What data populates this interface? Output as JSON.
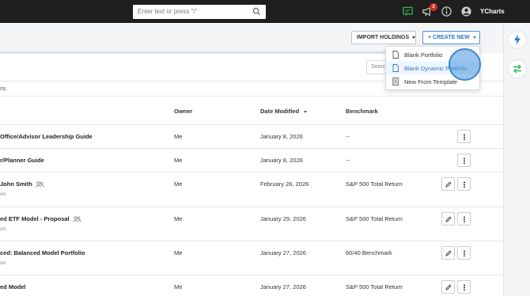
{
  "topbar": {
    "search_placeholder": "Enter text or press \"/\"",
    "notification_count": "2",
    "brand": "YCharts"
  },
  "toolbar": {
    "import_label": "IMPORT HOLDINGS",
    "create_label": "+ CREATE NEW",
    "search_placeholder": "Search"
  },
  "columns_fragment": "ns",
  "table": {
    "headers": {
      "owner": "Owner",
      "date_modified": "Date Modified",
      "benchmark": "Benchmark"
    },
    "rows": [
      {
        "name": "Office/Advisor Leadership Guide",
        "sub": "",
        "owner": "Me",
        "date": "January 8, 2026",
        "benchmark": "--",
        "shared": false,
        "editable": false
      },
      {
        "name": "r/Planner Guide",
        "sub": "",
        "owner": "Me",
        "date": "January 8, 2026",
        "benchmark": "--",
        "shared": false,
        "editable": false
      },
      {
        "name": "John Smith",
        "sub": "on",
        "owner": "Me",
        "date": "February 26, 2026",
        "benchmark": "S&P 500 Total Return",
        "shared": true,
        "editable": true
      },
      {
        "name": "ed ETF Model - Proposal",
        "sub": "on",
        "owner": "Me",
        "date": "January 29, 2026",
        "benchmark": "S&P 500 Total Return",
        "shared": true,
        "editable": true
      },
      {
        "name": "ced: Balanced Model Portfolio",
        "sub": "on",
        "owner": "Me",
        "date": "January 27, 2026",
        "benchmark": "60/40 Benchmark",
        "shared": false,
        "editable": true
      },
      {
        "name": "ed Model",
        "sub": "",
        "owner": "Me",
        "date": "January 27, 2026",
        "benchmark": "S&P 500 Total Return",
        "shared": false,
        "editable": true
      }
    ]
  },
  "create_menu": {
    "items": [
      {
        "label": "Blank Portfolio",
        "icon": "document-icon"
      },
      {
        "label": "Blank Dynamic Portfolio",
        "icon": "document-icon"
      },
      {
        "label": "New From Template",
        "icon": "template-icon"
      }
    ]
  },
  "colors": {
    "accent": "#2e7ac4",
    "topbar": "#1f1f1f",
    "badge": "#d42a2a",
    "green_icon": "#2eb85c"
  }
}
